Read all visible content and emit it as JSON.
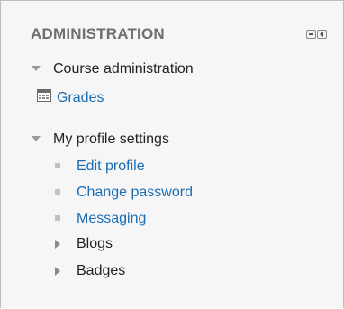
{
  "block": {
    "title": "ADMINISTRATION",
    "controls": [
      {
        "icon": "hide-block-icon"
      },
      {
        "icon": "dock-block-icon"
      }
    ]
  },
  "course_admin": {
    "label": "Course administration",
    "items": [
      {
        "label": "Grades",
        "icon": "grades-icon"
      }
    ]
  },
  "profile_settings": {
    "label": "My profile settings",
    "items": [
      {
        "label": "Edit profile"
      },
      {
        "label": "Change password"
      },
      {
        "label": "Messaging"
      },
      {
        "label": "Blogs",
        "collapsed": true
      },
      {
        "label": "Badges",
        "collapsed": true
      }
    ]
  },
  "colors": {
    "link": "#1a6db3",
    "text": "#222222",
    "title": "#6f6f6f",
    "background": "#f6f6f6"
  }
}
